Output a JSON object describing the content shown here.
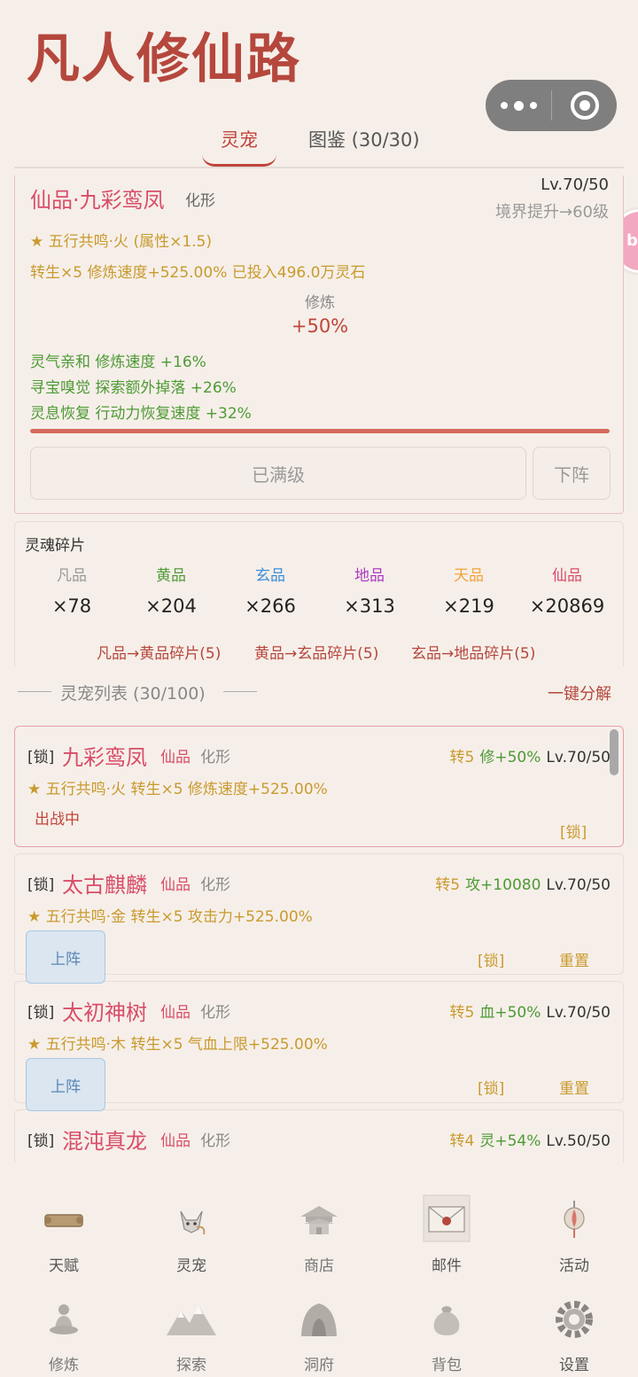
{
  "app": {
    "title": "凡人修仙路"
  },
  "tabs": [
    {
      "label": "灵宠"
    },
    {
      "label": "图鉴 (30/30)"
    }
  ],
  "side_bubble": "b",
  "current_pet": {
    "name": "仙品·九彩鸾凤",
    "form": "化形",
    "level": "Lv.70/50",
    "realm_hint": "境界提升→60级",
    "resonance": "★ 五行共鸣·火 (属性×1.5)",
    "stats": "转生×5  修炼速度+525.00%  已投入496.0万灵石",
    "train_label": "修炼",
    "train_value": "+50%",
    "bonuses": [
      "灵气亲和 修炼速度 +16%",
      "寻宝嗅觉 探索额外掉落 +26%",
      "灵息恢复 行动力恢复速度 +32%"
    ],
    "progress": 1.0,
    "max_button": "已满级",
    "down_button": "下阵"
  },
  "fragments": {
    "title": "灵魂碎片",
    "grades": [
      {
        "name": "凡品",
        "count": "×78",
        "color": "#9a9a9a"
      },
      {
        "name": "黄品",
        "count": "×204",
        "color": "#4e9a35"
      },
      {
        "name": "玄品",
        "count": "×266",
        "color": "#3b8fd9"
      },
      {
        "name": "地品",
        "count": "×313",
        "color": "#a93cc0"
      },
      {
        "name": "天品",
        "count": "×219",
        "color": "#f0a43a"
      },
      {
        "name": "仙品",
        "count": "×20869",
        "color": "#d84d6a"
      }
    ],
    "conversions": [
      "凡品→黄品碎片(5)",
      "黄品→玄品碎片(5)",
      "玄品→地品碎片(5)"
    ]
  },
  "pet_list": {
    "title": "灵宠列表 (30/100)",
    "decompose_all": "一键分解",
    "items": [
      {
        "lock": "[锁]",
        "name": "九彩鸾凤",
        "grade": "仙品",
        "form": "化形",
        "rebirth": "转5",
        "stat": "修+50%",
        "level": "Lv.70/50",
        "desc": "★ 五行共鸣·火  转生×5 修炼速度+525.00%",
        "status": "出战中",
        "lock_link": "[锁]"
      },
      {
        "lock": "[锁]",
        "name": "太古麒麟",
        "grade": "仙品",
        "form": "化形",
        "rebirth": "转5",
        "stat": "攻+10080",
        "level": "Lv.70/50",
        "desc": "★ 五行共鸣·金  转生×5 攻击力+525.00%",
        "deploy_button": "上阵",
        "lock_link": "[锁]",
        "reset_link": "重置"
      },
      {
        "lock": "[锁]",
        "name": "太初神树",
        "grade": "仙品",
        "form": "化形",
        "rebirth": "转5",
        "stat": "血+50%",
        "level": "Lv.70/50",
        "desc": "★ 五行共鸣·木  转生×5 气血上限+525.00%",
        "deploy_button": "上阵",
        "lock_link": "[锁]",
        "reset_link": "重置"
      },
      {
        "lock": "[锁]",
        "name": "混沌真龙",
        "grade": "仙品",
        "form": "化形",
        "rebirth": "转4",
        "stat": "灵+54%",
        "level": "Lv.50/50"
      }
    ]
  },
  "bottom_nav": [
    {
      "label": "天赋",
      "icon": "scroll-icon"
    },
    {
      "label": "灵宠",
      "icon": "fox-icon"
    },
    {
      "label": "商店",
      "icon": "pavilion-icon"
    },
    {
      "label": "邮件",
      "icon": "envelope-icon"
    },
    {
      "label": "活动",
      "icon": "lantern-icon"
    },
    {
      "label": "修炼",
      "icon": "meditation-icon"
    },
    {
      "label": "探索",
      "icon": "mountain-icon"
    },
    {
      "label": "洞府",
      "icon": "cave-icon"
    },
    {
      "label": "背包",
      "icon": "bag-icon"
    },
    {
      "label": "设置",
      "icon": "gear-icon"
    }
  ]
}
